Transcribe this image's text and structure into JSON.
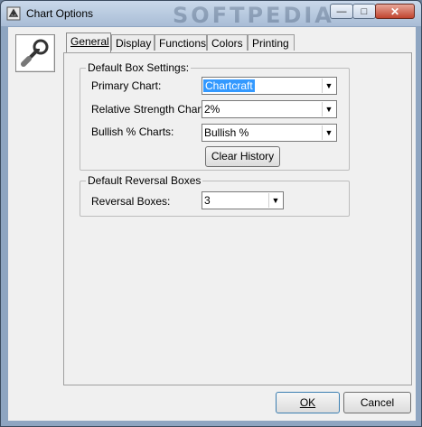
{
  "window": {
    "title": "Chart Options",
    "watermark": "SOFTPEDIA",
    "controls": {
      "minimize": "—",
      "maximize": "□",
      "close": "✕"
    }
  },
  "tabs": [
    {
      "label": "General",
      "active": true
    },
    {
      "label": "Display",
      "active": false
    },
    {
      "label": "Functions",
      "active": false
    },
    {
      "label": "Colors",
      "active": false
    },
    {
      "label": "Printing",
      "active": false
    }
  ],
  "default_box": {
    "legend": "Default Box Settings:",
    "primary_chart": {
      "label": "Primary Chart:",
      "value": "Chartcraft"
    },
    "relative_strength": {
      "label": "Relative Strength Chart:",
      "value": "2%"
    },
    "bullish_percent": {
      "label": "Bullish % Charts:",
      "value": "Bullish %"
    },
    "clear_history_label": "Clear History"
  },
  "default_reversal": {
    "legend": "Default Reversal Boxes",
    "reversal_boxes": {
      "label": "Reversal Boxes:",
      "value": "3"
    }
  },
  "footer": {
    "ok_label": "OK",
    "cancel_label": "Cancel"
  },
  "icons": {
    "app": "chart-options-icon",
    "logo": "chart-tool-icon",
    "dropdown": "dropdown-arrow-icon"
  }
}
